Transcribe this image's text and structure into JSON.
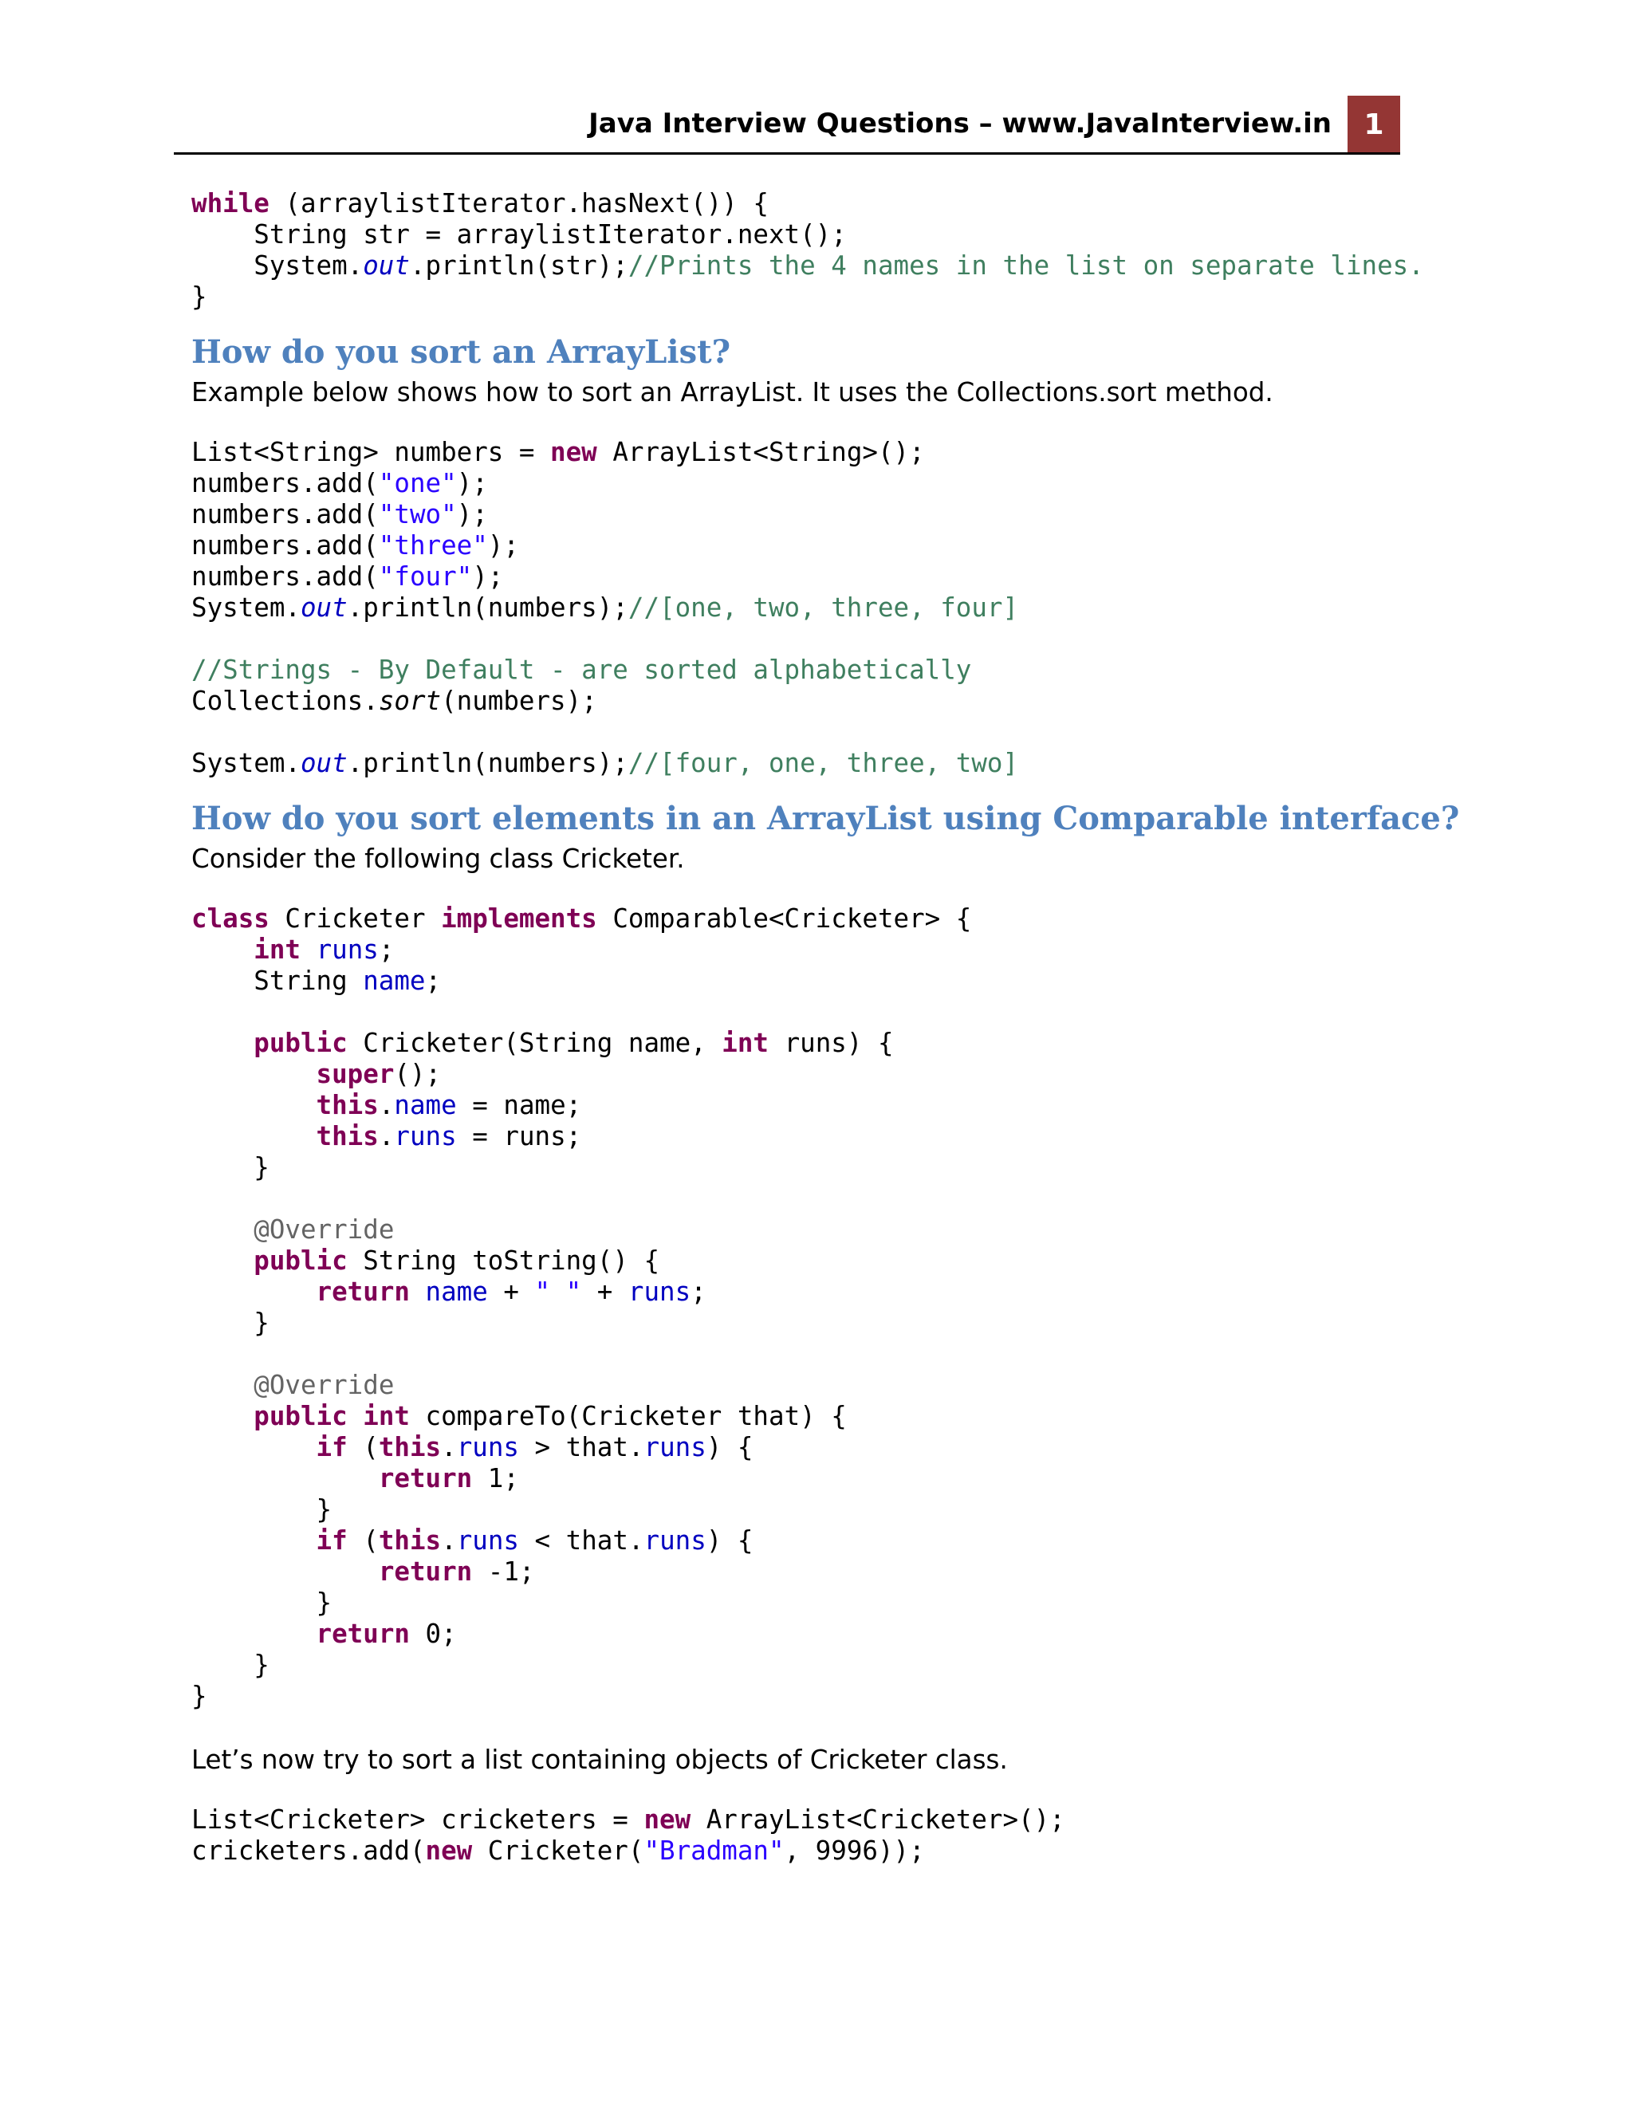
{
  "header": {
    "title": "Java Interview Questions – www.JavaInterview.in",
    "page_number": "1"
  },
  "colors": {
    "badge": "#943634",
    "heading": "#4f81bd",
    "keyword": "#7f0055",
    "string": "#2a00ff",
    "comment": "#3f7f5f",
    "field": "#0000c0"
  },
  "code1": {
    "line1": {
      "kw": "while",
      "rest": " (arraylistIterator.hasNext()) {"
    },
    "line2": {
      "text": "    String str = arraylistIterator.next();"
    },
    "line3": {
      "pre": "    System.",
      "out": "out",
      "post": ".println(str);",
      "comment": "//Prints the 4 names in the list on separate lines."
    },
    "line4": {
      "text": "}"
    }
  },
  "section1": {
    "heading": "How do you sort an ArrayList?",
    "paragraph": "Example below shows how to sort an ArrayList. It uses the Collections.sort method."
  },
  "code2": {
    "l1": {
      "pre": "List<String> numbers = ",
      "kw": "new",
      "post": " ArrayList<String>();"
    },
    "l2": {
      "pre": "numbers.add(",
      "str": "\"one\"",
      "post": ");"
    },
    "l3": {
      "pre": "numbers.add(",
      "str": "\"two\"",
      "post": ");"
    },
    "l4": {
      "pre": "numbers.add(",
      "str": "\"three\"",
      "post": ");"
    },
    "l5": {
      "pre": "numbers.add(",
      "str": "\"four\"",
      "post": ");"
    },
    "l6": {
      "pre": "System.",
      "out": "out",
      "post": ".println(numbers);",
      "comment": "//[one, two, three, four]"
    },
    "l8": {
      "comment": "//Strings - By Default - are sorted alphabetically"
    },
    "l9": {
      "pre": "Collections.",
      "method": "sort",
      "post": "(numbers);"
    },
    "l11": {
      "pre": "System.",
      "out": "out",
      "post": ".println(numbers);",
      "comment": "//[four, one, three, two]"
    }
  },
  "section2": {
    "heading": "How do you sort elements in an ArrayList using Comparable interface?",
    "paragraph": "Consider the following class Cricketer."
  },
  "code3": {
    "c1": {
      "kw1": "class",
      "mid1": " Cricketer ",
      "kw2": "implements",
      "post": " Comparable<Cricketer> {"
    },
    "c2": {
      "indent": "    ",
      "kw": "int",
      "sp": " ",
      "field": "runs",
      "post": ";"
    },
    "c3": {
      "pre": "    String ",
      "field": "name",
      "post": ";"
    },
    "c5": {
      "indent": "    ",
      "kw1": "public",
      "mid": " Cricketer(String name, ",
      "kw2": "int",
      "post": " runs) {"
    },
    "c6": {
      "indent": "        ",
      "kw": "super",
      "post": "();"
    },
    "c7": {
      "indent": "        ",
      "kw": "this",
      "dot": ".",
      "field": "name",
      "post": " = name;"
    },
    "c8": {
      "indent": "        ",
      "kw": "this",
      "dot": ".",
      "field": "runs",
      "post": " = runs;"
    },
    "c9": {
      "text": "    }"
    },
    "c11": {
      "indent": "    ",
      "ann": "@Override"
    },
    "c12": {
      "indent": "    ",
      "kw": "public",
      "post": " String toString() {"
    },
    "c13": {
      "indent": "        ",
      "kw": "return",
      "sp": " ",
      "field1": "name",
      "mid": " + ",
      "str": "\" \"",
      "mid2": " + ",
      "field2": "runs",
      "post": ";"
    },
    "c14": {
      "text": "    }"
    },
    "c16": {
      "indent": "    ",
      "ann": "@Override"
    },
    "c17": {
      "indent": "    ",
      "kw1": "public",
      "sp": " ",
      "kw2": "int",
      "post": " compareTo(Cricketer that) {"
    },
    "c18": {
      "indent": "        ",
      "kw1": "if",
      "open": " (",
      "kw2": "this",
      "dot": ".",
      "field1": "runs",
      "mid": " > that.",
      "field2": "runs",
      "post": ") {"
    },
    "c19": {
      "indent": "            ",
      "kw": "return",
      "post": " 1;"
    },
    "c20": {
      "text": "        }"
    },
    "c21": {
      "indent": "        ",
      "kw1": "if",
      "open": " (",
      "kw2": "this",
      "dot": ".",
      "field1": "runs",
      "mid": " < that.",
      "field2": "runs",
      "post": ") {"
    },
    "c22": {
      "indent": "            ",
      "kw": "return",
      "post": " -1;"
    },
    "c23": {
      "text": "        }"
    },
    "c24": {
      "indent": "        ",
      "kw": "return",
      "post": " 0;"
    },
    "c25": {
      "text": "    }"
    },
    "c26": {
      "text": "}"
    }
  },
  "section3": {
    "paragraph": "Let’s now try to sort a list containing objects of Cricketer class."
  },
  "code4": {
    "d1": {
      "pre": "List<Cricketer> cricketers = ",
      "kw": "new",
      "post": " ArrayList<Cricketer>();"
    },
    "d2": {
      "pre": "cricketers.add(",
      "kw": "new",
      "mid": " Cricketer(",
      "str": "\"Bradman\"",
      "post": ", 9996));"
    }
  }
}
